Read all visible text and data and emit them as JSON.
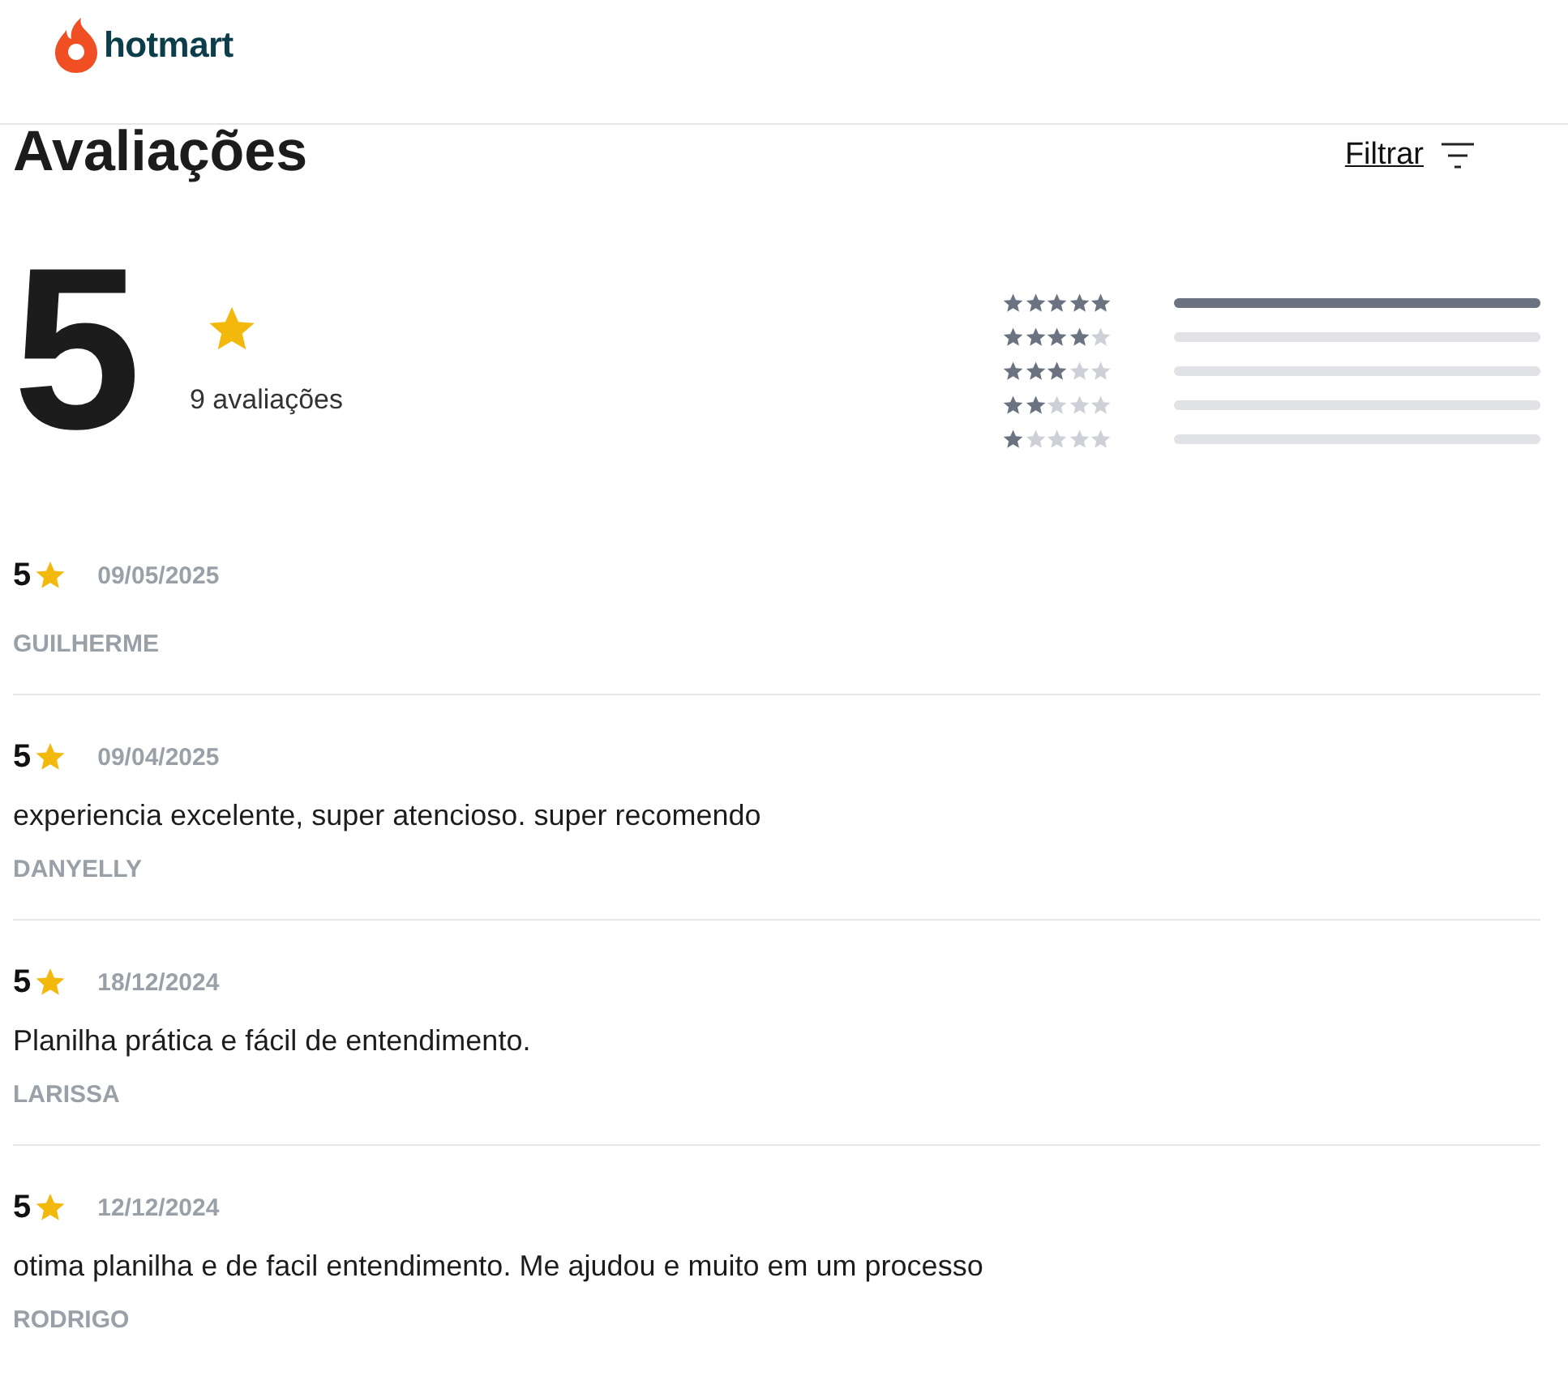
{
  "header": {
    "logo_text": "hotmart"
  },
  "title": "Avaliações",
  "filter": {
    "label": "Filtrar"
  },
  "summary": {
    "average": "5",
    "count": "9 avaliações"
  },
  "distribution": [
    {
      "stars": 5,
      "level": 1
    },
    {
      "stars": 4,
      "level": 0
    },
    {
      "stars": 3,
      "level": 0
    },
    {
      "stars": 2,
      "level": 0
    },
    {
      "stars": 1,
      "level": 0
    }
  ],
  "reviews": [
    {
      "rating": "5",
      "date": "09/05/2025",
      "author": "GUILHERME"
    },
    {
      "rating": "5",
      "date": "09/04/2025",
      "text": "experiencia excelente, super atencioso. super recomendo",
      "author": "DANYELLY"
    },
    {
      "rating": "5",
      "date": "18/12/2024",
      "text": "Planilha prática e fácil de entendimento.",
      "author": "LARISSA"
    },
    {
      "rating": "5",
      "date": "12/12/2024",
      "text": "otima planilha e de facil entendimento. Me ajudou e muito em um processo",
      "author": "RODRIGO"
    }
  ]
}
